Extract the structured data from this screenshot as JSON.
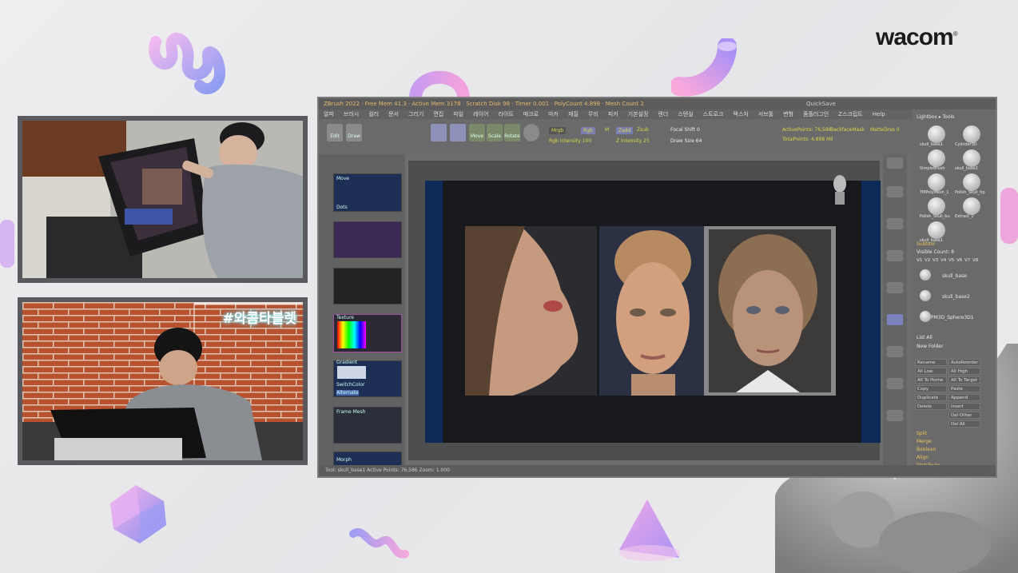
{
  "brand": {
    "logo_text": "wacom",
    "registered": "®"
  },
  "webcam_top": {
    "description_label": ""
  },
  "webcam_bottom": {
    "hashtag": "#와콤타블렛"
  },
  "app": {
    "title": "ZBrush 2022 · Free Mem 41.3 · Active Mem 3178 · Scratch Disk 98 · Timer 0.001 · PolyCount 4.898 · Mesh Count 2",
    "quicksave": "QuickSave",
    "menu": [
      "알파",
      "브러시",
      "컬러",
      "문서",
      "그리기",
      "편집",
      "파일",
      "레이어",
      "라이트",
      "매크로",
      "마커",
      "재질",
      "무비",
      "피커",
      "기본설정",
      "렌더",
      "스텐실",
      "스트로크",
      "텍스처",
      "서브툴",
      "변형",
      "줌플러그인",
      "Z스크립트",
      "Help"
    ],
    "toolbar": {
      "items": [
        "Edit",
        "Draw",
        "Move",
        "Scale",
        "Rotate"
      ],
      "labels": {
        "mrgb": "Mrgb",
        "rgb": "Rgb",
        "m": "M",
        "zadd": "Zadd",
        "zsub": "Zsub",
        "zcut": "Zcut",
        "rgb_intensity": "Rgb Intensity 100",
        "z_intensity": "Z Intensity 25",
        "focal": "Focal Shift 0",
        "draw_size": "Draw Size 64",
        "dynamic": "Dynamic",
        "active_points": "ActivePoints: 76,586",
        "total_points": "TotalPoints: 4,898 Mil",
        "backface": "BackfaceMask",
        "mattedres": "MatteDres 0",
        "lazy": "LazyMouse",
        "gizmo": "Gizmo"
      }
    },
    "left_panel": {
      "items": [
        "Move",
        "Dots",
        "",
        "",
        "Texture",
        "Gradient",
        "SwitchColor",
        "Alternate",
        "Frame Mesh",
        "Morph"
      ]
    },
    "right_panel": {
      "lightbox": "Lightbox ▸ Tools",
      "tool_label": "Tool",
      "subtools": [
        "skull_base1",
        "Cylinder3D",
        "SimpleBrush",
        "skull_base2",
        "TMPolyMesh_1",
        "Polish_Skull_hp",
        "Polish_Skull_bu",
        "Extract_2",
        "skull_base1"
      ],
      "subtool_header": "Subtool",
      "visible_count": "Visible Count: 8",
      "versions": [
        "V1",
        "V2",
        "V3",
        "V4",
        "V5",
        "V6",
        "V7",
        "V8"
      ],
      "layers": [
        "skull_base",
        "skull_base2",
        "PM3D_Sphere3D1"
      ],
      "list_all": "List All",
      "new_folder": "New Folder",
      "buttons_left": [
        "Rename",
        "All Low",
        "All To Home",
        "Copy",
        "Duplicate",
        "Delete"
      ],
      "buttons_right": [
        "AutoReorder",
        "All High",
        "All To Target",
        "Paste",
        "Append",
        "Insert",
        "Del Other",
        "Del All"
      ],
      "footer": [
        "Split",
        "Merge",
        "Boolean",
        "Align",
        "Distribute",
        "Remesh"
      ]
    },
    "status": "Tool: skull_base1   Active Points: 76,586   Zoom: 1.000"
  }
}
